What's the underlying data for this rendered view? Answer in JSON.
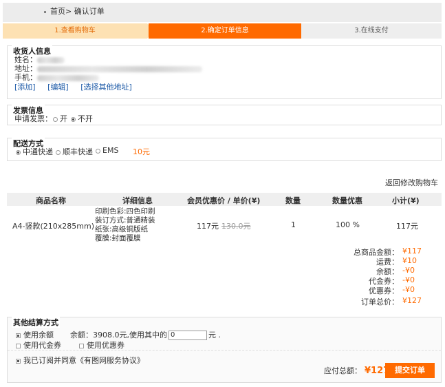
{
  "breadcrumb": {
    "home": "首页>",
    "current": "确认订单"
  },
  "steps": {
    "step1": "1.查看购物车",
    "step2": "2.确定订单信息",
    "step3": "3.在线支付"
  },
  "consignee": {
    "title": "收货人信息",
    "name_label": "姓名：",
    "address_label": "地址：",
    "phone_label": "手机：",
    "links": [
      "[添加]",
      "[编辑]",
      "[选择其他地址]"
    ]
  },
  "invoice": {
    "title": "发票信息",
    "label": "申请发票：",
    "opt_open": "开",
    "opt_close": "不开"
  },
  "delivery": {
    "title": "配送方式",
    "options": [
      "中通快递",
      "顺丰快递",
      "EMS"
    ],
    "fee": "10元"
  },
  "back_to_cart": "返回修改购物车",
  "table": {
    "headers": [
      "商品名称",
      "详细信息",
      "会员优惠价 / 单价(¥)",
      "数量",
      "数量优惠",
      "小计(¥)"
    ],
    "row": {
      "name": "A4-竖款(210x285mm)",
      "details": [
        "印刷色彩:四色印刷",
        "装订方式:普通精装",
        "纸张:高级铜版纸",
        "覆膜:封面覆膜"
      ],
      "price": "117元",
      "original_price": "130.0元",
      "quantity": "1",
      "discount": "100 %",
      "subtotal": "117元"
    }
  },
  "summary": [
    {
      "label": "总商品金额：",
      "value": "¥117"
    },
    {
      "label": "运费：",
      "value": "¥10"
    },
    {
      "label": "余额：",
      "value": "-¥0"
    },
    {
      "label": "代金券：",
      "value": "-¥0"
    },
    {
      "label": "优惠券：",
      "value": "-¥0"
    },
    {
      "label": "订单总价：",
      "value": "¥127"
    }
  ],
  "other_payment": {
    "title": "其他结算方式",
    "use_balance": "使用余额",
    "balance_text": "余额：3908.0元,使用其中的",
    "balance_input": "0",
    "balance_unit": "元 .",
    "use_voucher": "使用代金券",
    "use_coupon": "使用优惠券",
    "agreement": "我已订阅并同意《有图网服务协议》",
    "pay_total_label": "应付总额：",
    "pay_total_value": "¥127",
    "submit": "提交订单"
  },
  "colors": {
    "accent": "#ff6a00",
    "step_done": "#fde1b3",
    "link": "#1e5ba8"
  }
}
